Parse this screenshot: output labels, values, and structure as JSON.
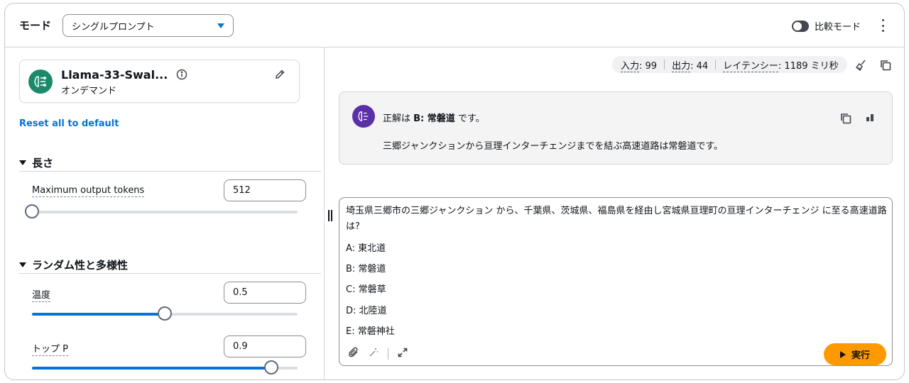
{
  "header": {
    "mode_label": "モード",
    "mode_select_value": "シングルプロンプト",
    "compare_label": "比較モード"
  },
  "model": {
    "name": "Llama-33-Swal...",
    "subtitle": "オンデマンド"
  },
  "reset_label": "Reset all to default",
  "length": {
    "section_title": "長さ",
    "max_tokens_label": "Maximum output tokens",
    "max_tokens_value": "512",
    "max_tokens_fraction": 0.0
  },
  "randomness": {
    "section_title": "ランダム性と多様性",
    "temperature_label": "温度",
    "temperature_value": "0.5",
    "temperature_fraction": 0.5,
    "top_p_label": "トップ P",
    "top_p_value": "0.9",
    "top_p_fraction": 0.9
  },
  "metrics": {
    "input_label": "入力",
    "input_value": ": 99",
    "output_label": "出力",
    "output_value": ": 44",
    "latency_label": "レイテンシー",
    "latency_value": ": 1189 ミリ秒"
  },
  "answer": {
    "prefix": "正解は ",
    "bold": "B: 常磐道",
    "suffix": " です。",
    "line2": "三郷ジャンクションから亘理インターチェンジまでを結ぶ高速道路は常磐道です。"
  },
  "prompt": {
    "question": "埼玉県三郷市の三郷ジャンクション から、千葉県、茨城県、福島県を経由し宮城県亘理町の亘理インターチェンジ に至る高速道路は?",
    "options": [
      "A: 東北道",
      "B: 常磐道",
      "C: 常磐草",
      "D: 北陸道",
      "E: 常磐神社"
    ],
    "run_label": "実行"
  },
  "colors": {
    "accent": "#0972d3",
    "run_button": "#ff9900",
    "model_logo": "#1b8a6b",
    "avatar": "#5b2fa8"
  }
}
